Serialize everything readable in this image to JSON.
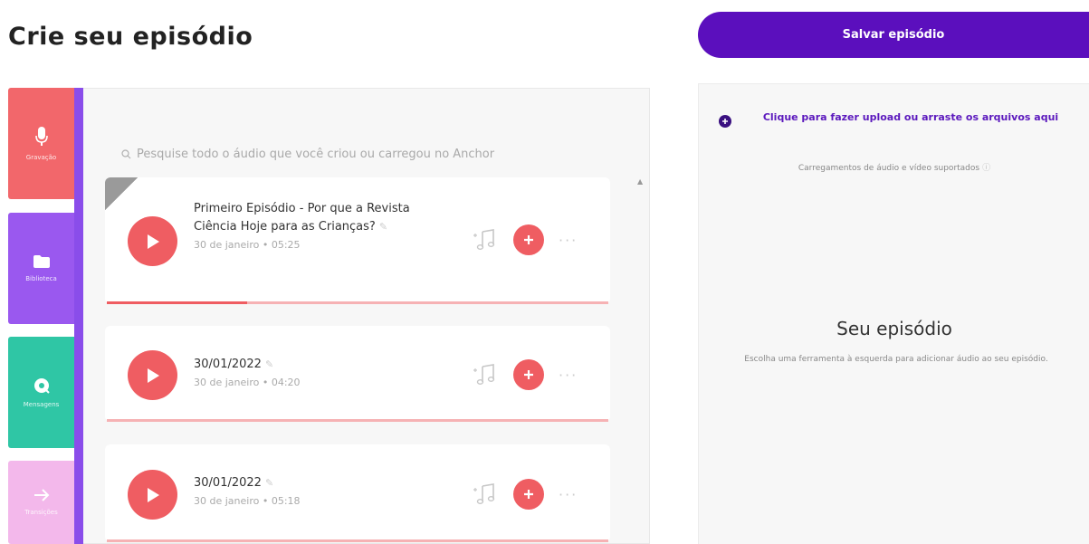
{
  "page": {
    "title": "Crie seu episódio"
  },
  "tools": [
    {
      "label": "Gravação",
      "icon": "microphone-icon",
      "color": "#f2676b"
    },
    {
      "label": "Biblioteca",
      "icon": "folder-icon",
      "color": "#9a58ef"
    },
    {
      "label": "Mensagens",
      "icon": "message-icon",
      "color": "#2fc6a5"
    },
    {
      "label": "Transições",
      "icon": "arrow-right-icon",
      "color": "#f3b8eb"
    }
  ],
  "library": {
    "search_placeholder": "Pesquise todo o áudio que você criou ou carregou no Anchor",
    "episodes": [
      {
        "title": "Primeiro Episódio - Por que a Revista Ciência Hoje para as Crianças?",
        "date": "30 de janeiro",
        "duration": "05:25",
        "progress": 0.28
      },
      {
        "title": "30/01/2022",
        "date": "30 de janeiro",
        "duration": "04:20",
        "progress": 0
      },
      {
        "title": "30/01/2022",
        "date": "30 de janeiro",
        "duration": "05:18",
        "progress": 0
      }
    ],
    "meta_separator": "•"
  },
  "save_button": {
    "label": "Salvar episódio"
  },
  "episode_panel": {
    "upload_link": "Clique para fazer upload ou arraste os arquivos aqui",
    "upload_sub": "Carregamentos de áudio e vídeo suportados",
    "title": "Seu episódio",
    "description": "Escolha uma ferramenta à esquerda para adicionar áudio ao seu episódio."
  },
  "colors": {
    "accent_red": "#ef5d62",
    "brand_purple": "#5b0fbd",
    "library_purple": "#9a58ef",
    "messages_green": "#2fc6a5"
  }
}
